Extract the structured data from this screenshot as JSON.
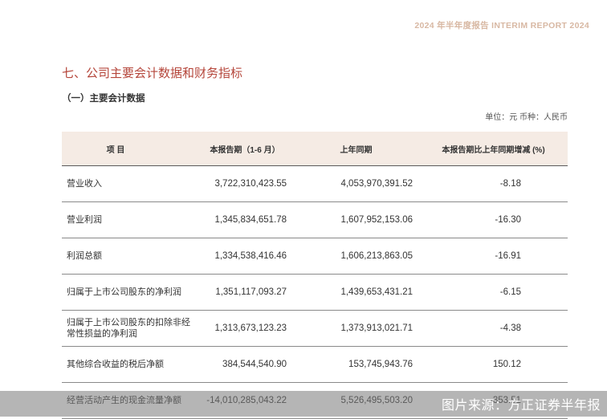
{
  "header": {
    "report_title": "2024 年半年度报告  INTERIM REPORT 2024"
  },
  "section": {
    "title": "七、公司主要会计数据和财务指标",
    "subtitle": "（一）主要会计数据",
    "unit_note": "单位：元  币种：人民币"
  },
  "table": {
    "headers": [
      "项  目",
      "本报告期（1-6 月）",
      "上年同期",
      "本报告期比上年同期增减 (%)"
    ],
    "rows": [
      {
        "item": "营业收入",
        "current": "3,722,310,423.55",
        "previous": "4,053,970,391.52",
        "change": "-8.18"
      },
      {
        "item": "营业利润",
        "current": "1,345,834,651.78",
        "previous": "1,607,952,153.06",
        "change": "-16.30"
      },
      {
        "item": "利润总额",
        "current": "1,334,538,416.46",
        "previous": "1,606,213,863.05",
        "change": "-16.91"
      },
      {
        "item": "归属于上市公司股东的净利润",
        "current": "1,351,117,093.27",
        "previous": "1,439,653,431.21",
        "change": "-6.15"
      },
      {
        "item": "归属于上市公司股东的扣除非经常性损益的净利润",
        "current": "1,313,673,123.23",
        "previous": "1,373,913,021.71",
        "change": "-4.38"
      },
      {
        "item": "其他综合收益的税后净额",
        "current": "384,544,540.90",
        "previous": "153,745,943.76",
        "change": "150.12"
      },
      {
        "item": "经营活动产生的现金流量净额",
        "current": "-14,010,285,043.22",
        "previous": "5,526,495,503.20",
        "change": "-353.51"
      }
    ]
  },
  "watermark": {
    "text": "图片来源：方正证券半年报"
  },
  "colors": {
    "title_red": "#b5463b",
    "header_bg": "#f5ebe4",
    "report_header": "#d8b8a3"
  }
}
